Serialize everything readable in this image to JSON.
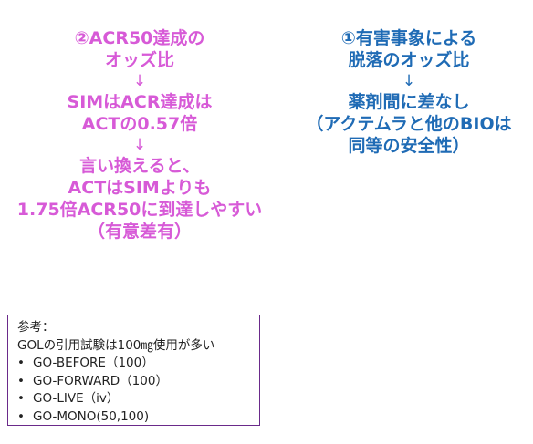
{
  "left": {
    "title_l1": "②ACR50達成の",
    "title_l2": "オッズ比",
    "arrow1": "↓",
    "l3": "SIMはACR達成は",
    "l4": "ACTの0.57倍",
    "arrow2": "↓",
    "l5": "言い換えると、",
    "l6": "ACTはSIMよりも",
    "l7": "1.75倍ACR50に到達しやすい",
    "l8": "（有意差有）"
  },
  "right": {
    "title_l1": "①有害事象による",
    "title_l2": "脱落のオッズ比",
    "arrow1": "↓",
    "l3": "薬剤間に差なし",
    "l4": "（アクテムラと他のBIOは",
    "l5": "同等の安全性）"
  },
  "reference": {
    "heading": "参考：",
    "intro": "GOLの引用試験は100㎎使用が多い",
    "bullet": "•",
    "items": [
      "GO-BEFORE（100）",
      "GO-FORWARD（100）",
      "GO-LIVE（iv）",
      "GO-MONO(50,100)"
    ]
  },
  "colors": {
    "left_text": "#d75ad7",
    "right_text": "#1f6bb5",
    "box_border": "#6a2a8a"
  }
}
